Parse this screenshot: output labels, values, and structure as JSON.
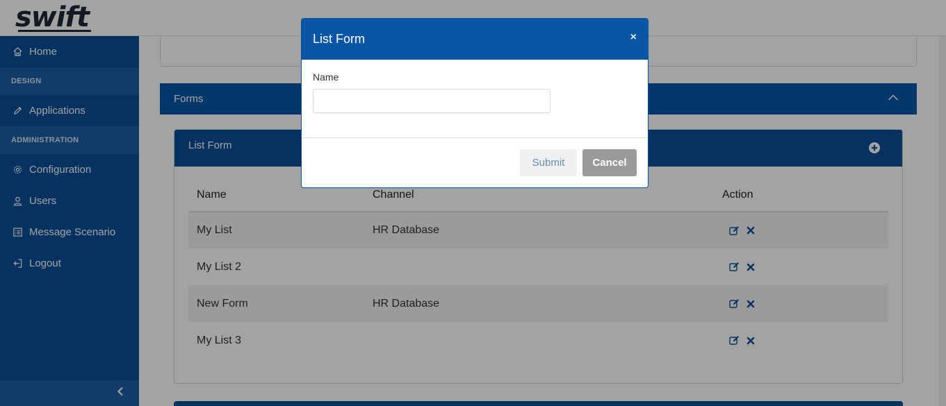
{
  "app": {
    "logo_text": "swift"
  },
  "sidebar": {
    "items": [
      {
        "type": "item",
        "label": "Home",
        "icon": "home-icon"
      },
      {
        "type": "section",
        "label": "DESIGN"
      },
      {
        "type": "item",
        "label": "Applications",
        "icon": "pencil-icon"
      },
      {
        "type": "section",
        "label": "ADMINISTRATION"
      },
      {
        "type": "item",
        "label": "Configuration",
        "icon": "gear-icon"
      },
      {
        "type": "item",
        "label": "Users",
        "icon": "user-icon"
      },
      {
        "type": "item",
        "label": "Message Scenario",
        "icon": "list-icon"
      },
      {
        "type": "item",
        "label": "Logout",
        "icon": "logout-icon"
      }
    ],
    "collapse_icon": "chevron-left-icon"
  },
  "forms_panel": {
    "title": "Forms",
    "toggle_icon": "chevron-up-icon"
  },
  "list_form_card": {
    "title": "List Form",
    "add_icon": "plus-circle-icon",
    "columns": [
      "Name",
      "Channel",
      "Action"
    ],
    "rows": [
      {
        "name": "My List",
        "channel": "HR Database"
      },
      {
        "name": "My List 2",
        "channel": ""
      },
      {
        "name": "New Form",
        "channel": "HR Database"
      },
      {
        "name": "My List 3",
        "channel": ""
      }
    ],
    "row_action_icons": [
      "edit-icon",
      "delete-icon"
    ]
  },
  "modal": {
    "title": "List Form",
    "close_label": "×",
    "field_label": "Name",
    "field_value": "",
    "field_placeholder": "",
    "submit_label": "Submit",
    "cancel_label": "Cancel"
  },
  "colors": {
    "sidebar_bg": "#0a4f99",
    "header_blue": "#0a55a5",
    "overlay": "rgba(0,0,0,0.36)",
    "cancel_bg": "#9a9a9a",
    "submit_text": "#6c8bb0"
  }
}
